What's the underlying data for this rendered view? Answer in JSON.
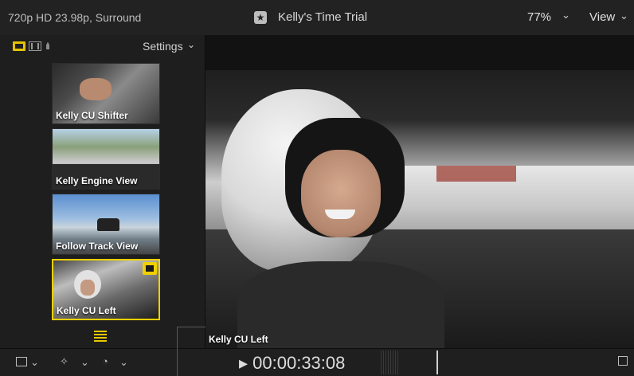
{
  "header": {
    "format": "720p HD 23.98p, Surround",
    "title": "Kelly's Time Trial",
    "zoom": "77%",
    "view_label": "View"
  },
  "angle_viewer": {
    "settings_label": "Settings",
    "angles": [
      {
        "label": "Kelly CU Shifter",
        "active": false
      },
      {
        "label": "Kelly Engine View",
        "active": false
      },
      {
        "label": "Follow Track View",
        "active": false
      },
      {
        "label": "Kelly CU Left",
        "active": true
      }
    ]
  },
  "viewer": {
    "clip_label": "Kelly CU Left"
  },
  "transport": {
    "timecode": "00:00:33:08"
  },
  "colors": {
    "accent": "#f0d000"
  }
}
